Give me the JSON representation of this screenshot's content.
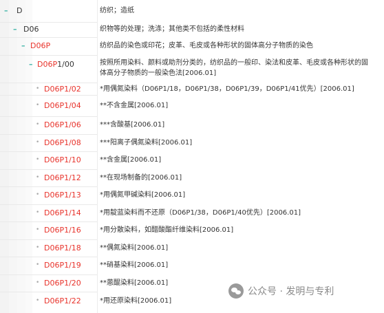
{
  "rows": [
    {
      "level": 1,
      "marker": "–",
      "code": "D",
      "code_color": "dark",
      "desc": "纺织；造纸"
    },
    {
      "level": 2,
      "marker": "–",
      "code": "D06",
      "code_color": "dark",
      "desc": "织物等的处理；洗涤；其他类不包括的柔性材料"
    },
    {
      "level": 3,
      "marker": "–",
      "code": "D06P",
      "code_color": "red",
      "desc": "纺织品的染色或印花；皮革、毛皮或各种形状的固体高分子物质的染色"
    },
    {
      "level": 4,
      "marker": "–",
      "code_red": "D06P",
      "code_rest": "1/00",
      "desc": "按照所用染料、颜料或助剂分类的，纺织品的一般印、染法和皮革、毛皮或各种形状的固体高分子物质的一般染色法[2006.01]"
    },
    {
      "level": 5,
      "marker": "•",
      "code": "D06P1/02",
      "desc": "*用偶氮染料（D06P1/18，D06P1/38，D06P1/39，D06P1/41优先）[2006.01]"
    },
    {
      "level": 5,
      "marker": "•",
      "code": "D06P1/04",
      "desc": "**不含金属[2006.01]"
    },
    {
      "level": 5,
      "marker": "•",
      "code": "D06P1/06",
      "desc": "***含酸基[2006.01]"
    },
    {
      "level": 5,
      "marker": "•",
      "code": "D06P1/08",
      "desc": "***阳离子偶氮染料[2006.01]"
    },
    {
      "level": 5,
      "marker": "•",
      "code": "D06P1/10",
      "desc": "**含金属[2006.01]"
    },
    {
      "level": 5,
      "marker": "•",
      "code": "D06P1/12",
      "desc": "**在现场制备的[2006.01]"
    },
    {
      "level": 5,
      "marker": "•",
      "code": "D06P1/13",
      "desc": "*用偶氮甲碱染料[2006.01]"
    },
    {
      "level": 5,
      "marker": "•",
      "code": "D06P1/14",
      "desc": "*用靛蓝染料而不还原（D06P1/38，D06P1/40优先）[2006.01]"
    },
    {
      "level": 5,
      "marker": "•",
      "code": "D06P1/16",
      "desc": "*用分散染料，如醋酸酯纤维染料[2006.01]"
    },
    {
      "level": 5,
      "marker": "•",
      "code": "D06P1/18",
      "desc": "**偶氮染料[2006.01]"
    },
    {
      "level": 5,
      "marker": "•",
      "code": "D06P1/19",
      "desc": "**硝基染料[2006.01]"
    },
    {
      "level": 5,
      "marker": "•",
      "code": "D06P1/20",
      "desc": "**蒽醌染料[2006.01]"
    },
    {
      "level": 5,
      "marker": "•",
      "code": "D06P1/22",
      "desc": "*用还原染料[2006.01]"
    }
  ],
  "watermark": {
    "text": "公众号 · 发明与专利",
    "icon": "wechat-icon"
  },
  "colors": {
    "red_code": "#e8322a",
    "dash_marker": "#3fb5a8",
    "dot_marker": "#aaaaaa",
    "text": "#333333"
  }
}
